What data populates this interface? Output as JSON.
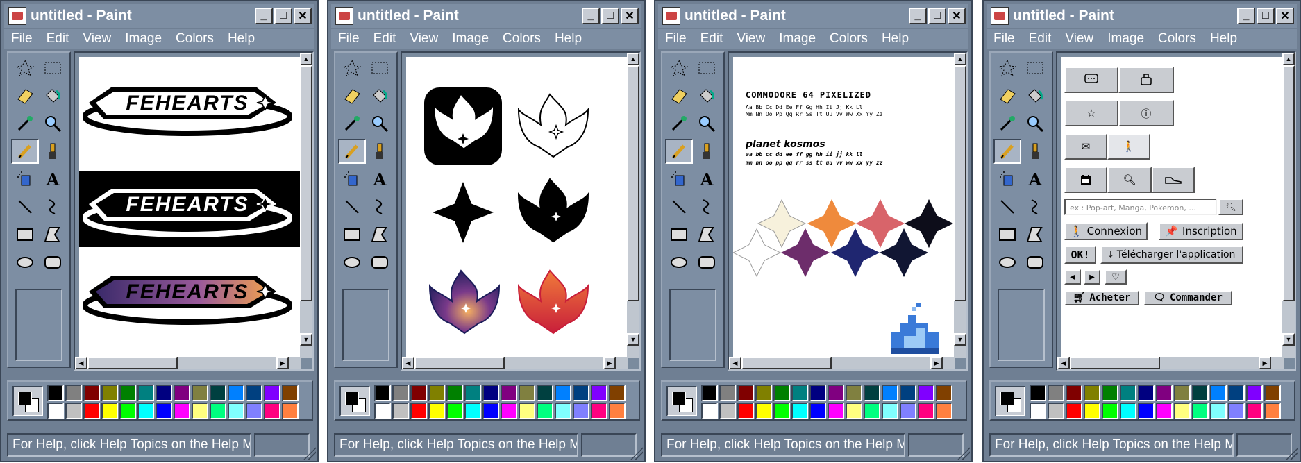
{
  "window": {
    "title": "untitled - Paint",
    "controls": {
      "minimize": "_",
      "maximize": "□",
      "close": "✕"
    }
  },
  "menu": [
    "File",
    "Edit",
    "View",
    "Image",
    "Colors",
    "Help"
  ],
  "status": {
    "help_text": "For Help, click Help Topics on the Help Me"
  },
  "palette": {
    "top": [
      "#000000",
      "#808080",
      "#800000",
      "#808000",
      "#008000",
      "#008080",
      "#000080",
      "#800080",
      "#808040",
      "#004040",
      "#0080ff",
      "#004080",
      "#8000ff",
      "#804000"
    ],
    "bottom": [
      "#ffffff",
      "#c0c0c0",
      "#ff0000",
      "#ffff00",
      "#00ff00",
      "#00ffff",
      "#0000ff",
      "#ff00ff",
      "#ffff80",
      "#00ff80",
      "#80ffff",
      "#8080ff",
      "#ff0080",
      "#ff8040"
    ]
  },
  "panel1": {
    "logo_text": "FEHEARTS"
  },
  "panel3": {
    "font1_title": "COMMODORE 64 PIXELIZED",
    "font1_line1": "Aa Bb Cc Dd Ee Ff Gg Hh Ii Jj Kk Ll",
    "font1_line2": "Mm Nn Oo Pp Qq Rr Ss Tt Uu Vv Ww Xx Yy Zz",
    "font2_title": "planet kosmos",
    "font2_line1": "aa bb cc dd ee ff gg hh ii jj kk ll",
    "font2_line2": "mm nn oo pp qq rr ss tt uu vv ww xx yy zz",
    "star_colors": [
      "#f7f1dc",
      "#ef8a3c",
      "#d8646a",
      "#0d0d1a",
      "#ffffff",
      "#6d2d6b",
      "#1f2670",
      "#111633"
    ]
  },
  "panel4": {
    "search_placeholder": "ex : Pop-art, Manga, Pokemon, ...",
    "login_label": "Connexion",
    "signup_label": "Inscription",
    "ok_label": "OK!",
    "download_label": "Télécharger l'application",
    "buy_label": "Acheter",
    "order_label": "Commander"
  }
}
